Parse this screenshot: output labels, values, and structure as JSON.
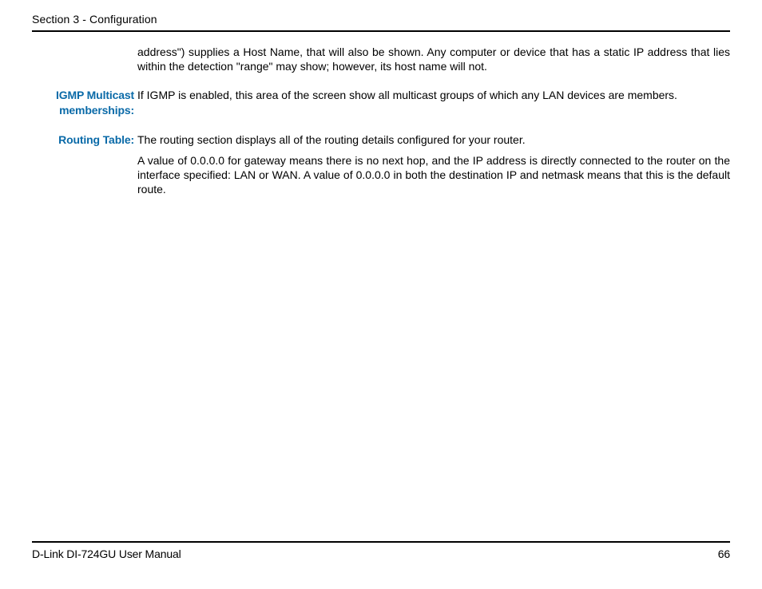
{
  "header": {
    "section_title": "Section 3 - Configuration"
  },
  "content": {
    "intro_continuation": "address\") supplies a Host Name, that will also be shown. Any computer or device that has a static IP address that lies within the detection \"range\" may show; however, its host name will not.",
    "igmp": {
      "label": "IGMP Multicast memberships:",
      "text": "If IGMP is enabled, this area of the screen show all multicast groups of which any LAN devices are members."
    },
    "routing": {
      "label": "Routing Table:",
      "p1": "The routing section displays all of the routing details configured for your router.",
      "p2": "A value of 0.0.0.0 for gateway means there is no next hop, and the IP address is directly connected to the router on the interface specified: LAN or WAN. A value of 0.0.0.0 in both the destination IP and netmask means that this is the default route."
    }
  },
  "footer": {
    "manual": "D-Link DI-724GU User Manual",
    "page_number": "66"
  }
}
